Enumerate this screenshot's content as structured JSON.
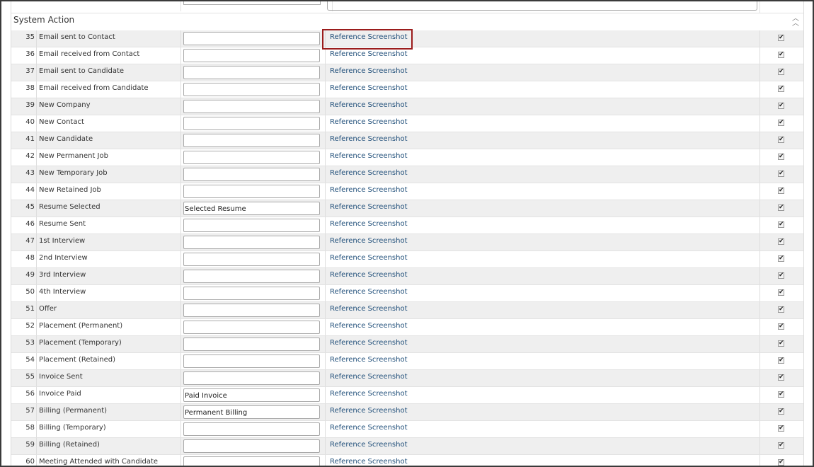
{
  "section": {
    "title": "System Action",
    "collapse_icon": "double-chevron-up-icon"
  },
  "link_label": "Reference Screenshot",
  "rows": [
    {
      "num": "35",
      "label": "Email sent to Contact",
      "value": "",
      "checked": true
    },
    {
      "num": "36",
      "label": "Email received from Contact",
      "value": "",
      "checked": true
    },
    {
      "num": "37",
      "label": "Email sent to Candidate",
      "value": "",
      "checked": true
    },
    {
      "num": "38",
      "label": "Email received from Candidate",
      "value": "",
      "checked": true
    },
    {
      "num": "39",
      "label": "New Company",
      "value": "",
      "checked": true
    },
    {
      "num": "40",
      "label": "New Contact",
      "value": "",
      "checked": true
    },
    {
      "num": "41",
      "label": "New Candidate",
      "value": "",
      "checked": true
    },
    {
      "num": "42",
      "label": "New Permanent Job",
      "value": "",
      "checked": true
    },
    {
      "num": "43",
      "label": "New Temporary Job",
      "value": "",
      "checked": true
    },
    {
      "num": "44",
      "label": "New Retained Job",
      "value": "",
      "checked": true
    },
    {
      "num": "45",
      "label": "Resume Selected",
      "value": "Selected Resume",
      "checked": true
    },
    {
      "num": "46",
      "label": "Resume Sent",
      "value": "",
      "checked": true
    },
    {
      "num": "47",
      "label": "1st Interview",
      "value": "",
      "checked": true
    },
    {
      "num": "48",
      "label": "2nd Interview",
      "value": "",
      "checked": true
    },
    {
      "num": "49",
      "label": "3rd Interview",
      "value": "",
      "checked": true
    },
    {
      "num": "50",
      "label": "4th Interview",
      "value": "",
      "checked": true
    },
    {
      "num": "51",
      "label": "Offer",
      "value": "",
      "checked": true
    },
    {
      "num": "52",
      "label": "Placement (Permanent)",
      "value": "",
      "checked": true
    },
    {
      "num": "53",
      "label": "Placement (Temporary)",
      "value": "",
      "checked": true
    },
    {
      "num": "54",
      "label": "Placement (Retained)",
      "value": "",
      "checked": true
    },
    {
      "num": "55",
      "label": "Invoice Sent",
      "value": "",
      "checked": true
    },
    {
      "num": "56",
      "label": "Invoice Paid",
      "value": "Paid Invoice",
      "checked": true
    },
    {
      "num": "57",
      "label": "Billing (Permanent)",
      "value": "Permanent Billing",
      "checked": true
    },
    {
      "num": "58",
      "label": "Billing (Temporary)",
      "value": "",
      "checked": true
    },
    {
      "num": "59",
      "label": "Billing (Retained)",
      "value": "",
      "checked": true
    },
    {
      "num": "60",
      "label": "Meeting Attended with Candidate",
      "value": "",
      "checked": true
    }
  ],
  "colors": {
    "link": "#1f4e79",
    "highlight": "#9b1c1c",
    "row_alt": "#efefef"
  }
}
